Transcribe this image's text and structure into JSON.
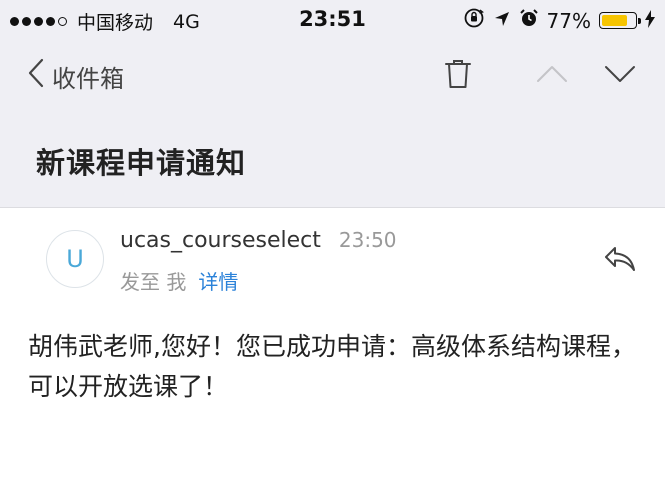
{
  "status_bar": {
    "carrier": "中国移动",
    "network": "4G",
    "time": "23:51",
    "battery_percent": "77%",
    "battery_level": 0.77,
    "battery_color": "#f6c400"
  },
  "nav": {
    "back_label": "收件箱",
    "icons": [
      "chevron-left-icon",
      "trash-icon",
      "chevron-up-icon",
      "chevron-down-icon"
    ]
  },
  "subject": "新课程申请通知",
  "message": {
    "avatar_letter": "U",
    "sender": "ucas_courseselect",
    "time": "23:50",
    "to_label": "发至 我",
    "details_label": "详情",
    "body": "胡伟武老师,您好！您已成功申请：高级体系结构课程，可以开放选课了！"
  },
  "colors": {
    "accent": "#2b82d9",
    "avatar_letter": "#4aa8d8",
    "header_background": "#efeff4"
  }
}
